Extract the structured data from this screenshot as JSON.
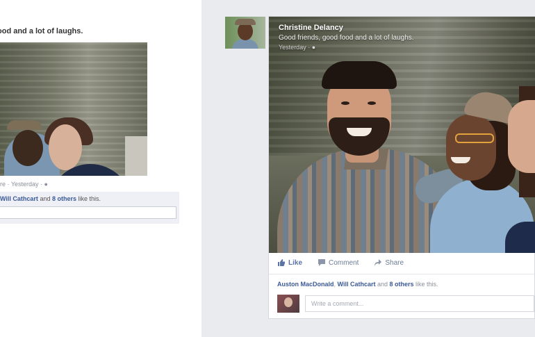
{
  "old_feed": {
    "caption": "ood and a lot of laughs.",
    "meta": "ire · Yesterday · ",
    "likes": {
      "names": "Will Cathcart",
      "connector": " and ",
      "others": "8 others",
      "suffix": " like this."
    },
    "comment_placeholder": ""
  },
  "new_feed": {
    "author": "Christine Delancy",
    "text": "Good friends, good food and a lot of laughs.",
    "timestamp": "Yesterday · ",
    "actions": {
      "like": "Like",
      "comment": "Comment",
      "share": "Share"
    },
    "likes": {
      "name1": "Auston MacDonald",
      "sep1": ", ",
      "name2": "Will Cathcart",
      "connector": " and ",
      "others": "8 others",
      "suffix": " like this."
    },
    "comment_placeholder": "Write a comment..."
  },
  "colors": {
    "accent": "#3b5998",
    "pane_bg": "#e9ebee"
  },
  "icons": [
    "like-icon",
    "comment-icon",
    "share-icon",
    "privacy-icon"
  ]
}
